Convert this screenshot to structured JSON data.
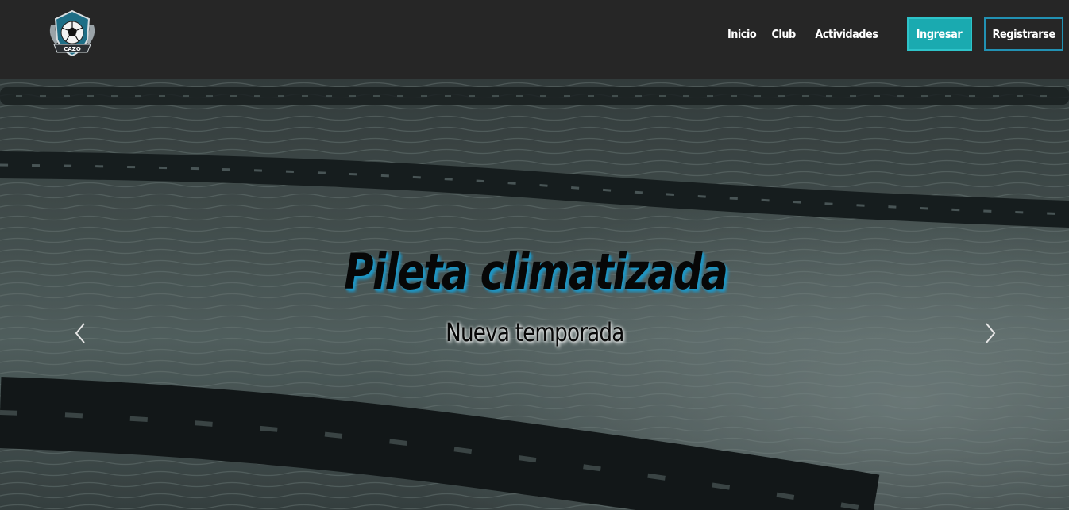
{
  "brand": {
    "logo_icon": "soccer-ball-shield-logo",
    "logo_text": "CAZO"
  },
  "nav": {
    "links": [
      {
        "label": "Inicio"
      },
      {
        "label": "Club"
      },
      {
        "label": "Actividades"
      }
    ],
    "login_label": "Ingresar",
    "register_label": "Registrarse"
  },
  "hero": {
    "title": "Pileta climatizada",
    "subtitle": "Nueva temporada",
    "prev_icon": "chevron-left-icon",
    "next_icon": "chevron-right-icon"
  },
  "colors": {
    "navbar_bg": "#262626",
    "login_bg": "#1aaab0",
    "register_border": "#2291b3",
    "title_shadow": "#1f96c4"
  }
}
